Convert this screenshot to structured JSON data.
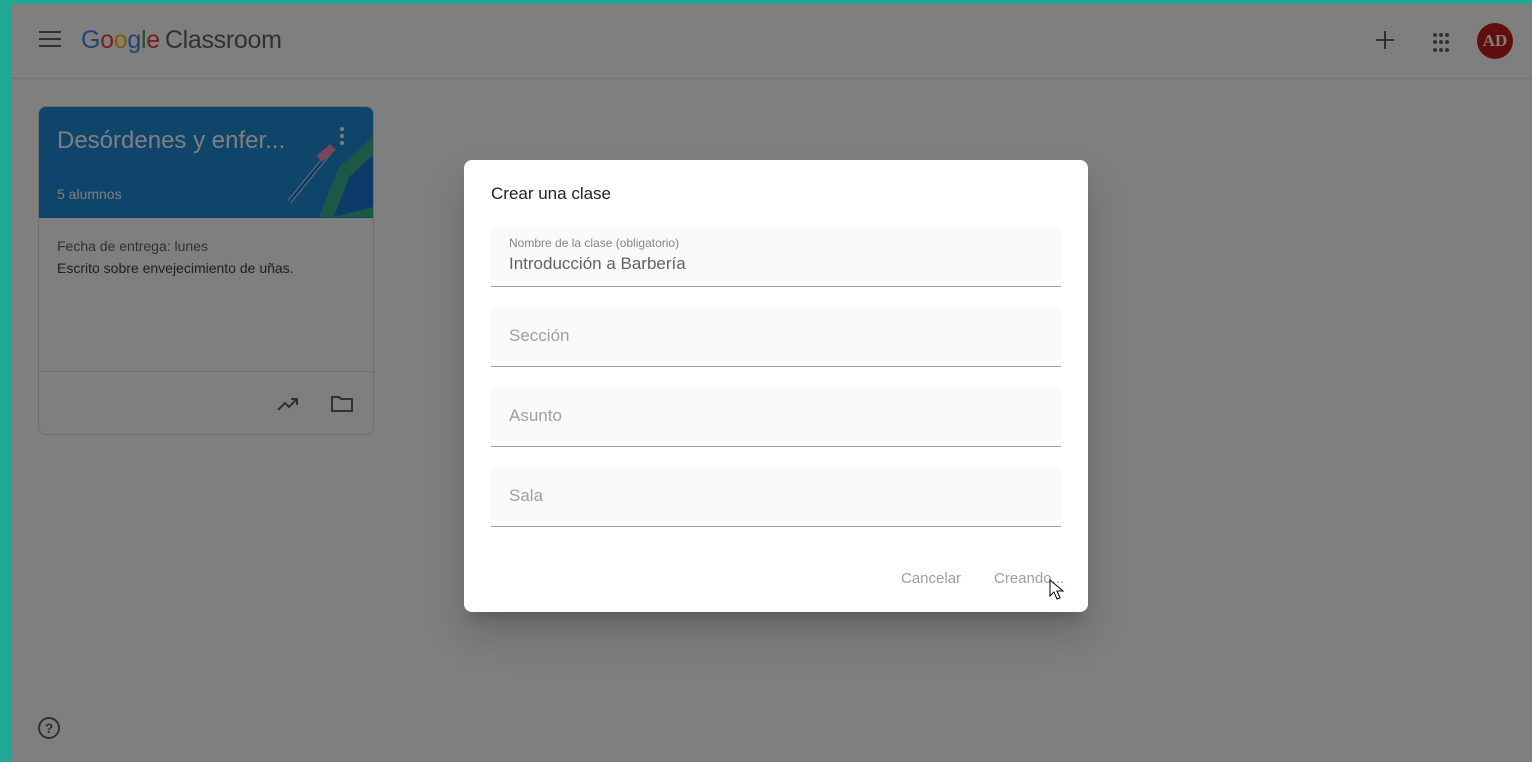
{
  "header": {
    "logo_google": [
      "G",
      "o",
      "o",
      "g",
      "l",
      "e"
    ],
    "logo_colors": [
      "#4285f4",
      "#ea4335",
      "#fbbc05",
      "#4285f4",
      "#34a853",
      "#ea4335"
    ],
    "logo_product": "Classroom",
    "avatar_initials": "AD"
  },
  "card": {
    "title": "Desórdenes y enfer...",
    "students": "5 alumnos",
    "due_date": "Fecha de entrega: lunes",
    "assignment": "Escrito sobre envejecimiento de uñas.",
    "banner_color": "#1e88d6"
  },
  "help": {
    "glyph": "?"
  },
  "dialog": {
    "title": "Crear una clase",
    "class_name_label": "Nombre de la clase (obligatorio)",
    "class_name_value": "Introducción a Barbería",
    "section_placeholder": "Sección",
    "subject_placeholder": "Asunto",
    "room_placeholder": "Sala",
    "cancel_label": "Cancelar",
    "create_label": "Creando..."
  }
}
